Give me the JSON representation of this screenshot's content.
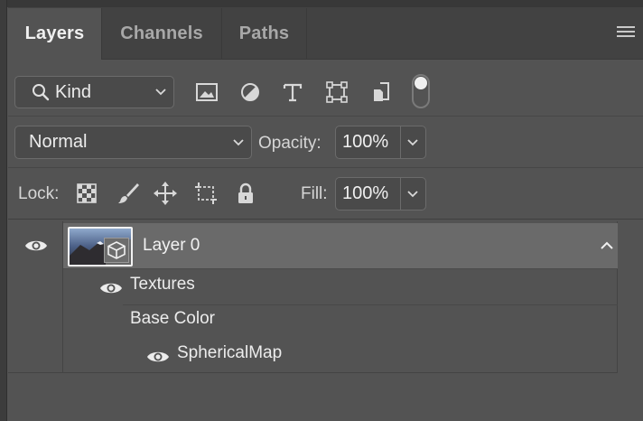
{
  "tabs": [
    {
      "label": "Layers",
      "active": true
    },
    {
      "label": "Channels",
      "active": false
    },
    {
      "label": "Paths",
      "active": false
    }
  ],
  "filter": {
    "kind_label": "Kind"
  },
  "blend": {
    "mode": "Normal",
    "opacity_label": "Opacity:",
    "opacity_value": "100%"
  },
  "lock": {
    "label": "Lock:",
    "fill_label": "Fill:",
    "fill_value": "100%"
  },
  "layers": [
    {
      "name": "Layer 0",
      "visible": true,
      "selected": true
    }
  ],
  "sublayers": {
    "textures": "Textures",
    "base_color": "Base Color",
    "spherical_map": "SphericalMap"
  },
  "colors": {
    "panel": "#535353",
    "selected_row": "#6a6a6a",
    "tabbar": "#424242"
  }
}
